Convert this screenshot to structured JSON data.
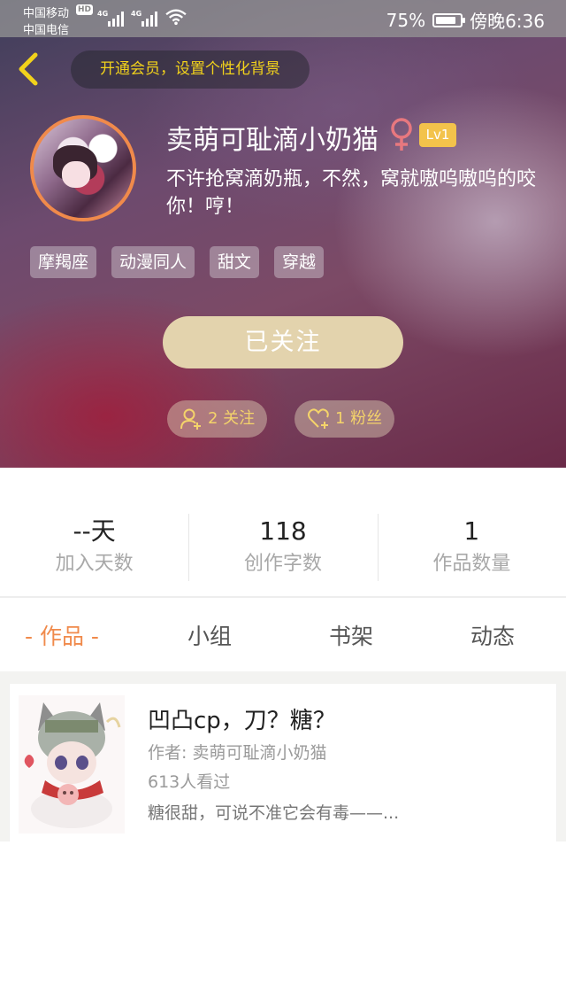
{
  "status_bar": {
    "carrier_1": "中国移动",
    "hd": "HD",
    "net_1": "4G",
    "net_2": "4G",
    "carrier_2": "中国电信",
    "battery": "75%",
    "time": "傍晚6:36"
  },
  "header": {
    "vip_banner": "开通会员，设置个性化背景"
  },
  "profile": {
    "username": "卖萌可耻滴小奶猫",
    "gender_symbol": "♀",
    "level": "Lv1",
    "bio": "不许抢窝滴奶瓶，不然，窝就嗷呜嗷呜的咬你！哼！",
    "tags": [
      "摩羯座",
      "动漫同人",
      "甜文",
      "穿越"
    ],
    "follow_button": "已关注",
    "following": "2 关注",
    "followers": "1 粉丝"
  },
  "stats": [
    {
      "value": "--天",
      "label": "加入天数"
    },
    {
      "value": "118",
      "label": "创作字数"
    },
    {
      "value": "1",
      "label": "作品数量"
    }
  ],
  "tabs": [
    "- 作品 -",
    "小组",
    "书架",
    "动态"
  ],
  "works": [
    {
      "title": "凹凸cp，刀？糖？",
      "author": "作者: 卖萌可耻滴小奶猫",
      "views": "613人看过",
      "description": "糖很甜，可说不准它会有毒——..."
    }
  ],
  "colors": {
    "accent_orange": "#f08a4b",
    "vip_yellow": "#f2d21b",
    "level_badge": "#f3c34b",
    "follow_button": "#e3d3ad",
    "gender_pink": "#e8787f"
  }
}
